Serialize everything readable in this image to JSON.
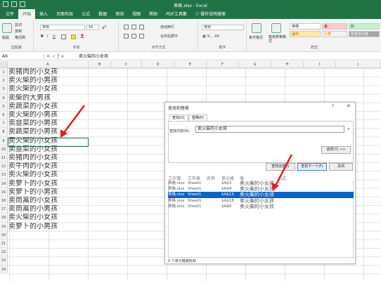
{
  "window": {
    "title": "表格.xlsx - Excel"
  },
  "tabs": [
    "文件",
    "开始",
    "插入",
    "页面布局",
    "公式",
    "数据",
    "审阅",
    "视图",
    "帮助",
    "PDF工具集"
  ],
  "active_tab": "开始",
  "tell_me": "操作说明搜索",
  "ribbon": {
    "clipboard": {
      "label": "剪贴板",
      "paste": "粘贴",
      "cut": "剪切",
      "copy": "复制",
      "format_painter": "格式刷"
    },
    "font": {
      "label": "字体",
      "font_name": "宋体",
      "font_size": "16"
    },
    "alignment": {
      "label": "对齐方式",
      "wrap": "自动换行",
      "merge": "合并后居中"
    },
    "number": {
      "label": "数字",
      "format": "常规"
    },
    "styles": {
      "label": "样式",
      "conditional": "条件格式",
      "table": "套用表格格式",
      "normal": "常规",
      "bad": "差",
      "good": "好",
      "neutral": "适中",
      "calc": "计算",
      "check": "检查单元格"
    }
  },
  "formula_bar": {
    "name_box": "A9",
    "content": "卖火柴的小女孩"
  },
  "columns": [
    "A",
    "B",
    "C",
    "D",
    "E",
    "F",
    "G",
    "H",
    "I",
    "J"
  ],
  "rows": [
    {
      "num": "1",
      "a": "卖猪肉的小女孩"
    },
    {
      "num": "2",
      "a": "卖火柴的小男孩"
    },
    {
      "num": "3",
      "a": "卖火柴的小女孩"
    },
    {
      "num": "4",
      "a": "卖柴的大男孩"
    },
    {
      "num": "5",
      "a": "卖蔬菜的小女孩"
    },
    {
      "num": "6",
      "a": "卖火柴的小男孩"
    },
    {
      "num": "7",
      "a": "卖韭菜的小男孩"
    },
    {
      "num": "8",
      "a": "卖蔬菜的小男孩"
    },
    {
      "num": "9",
      "a": "卖火柴的小女孩"
    },
    {
      "num": "10",
      "a": "卖韭菜的小女孩"
    },
    {
      "num": "11",
      "a": "卖猪肉的小女孩"
    },
    {
      "num": "12",
      "a": "卖牛肉的小女孩"
    },
    {
      "num": "13",
      "a": "卖火柴的小女孩"
    },
    {
      "num": "14",
      "a": "卖萝卜的小女孩"
    },
    {
      "num": "15",
      "a": "卖萝卜的小男孩"
    },
    {
      "num": "16",
      "a": "卖茼蒿的小女孩"
    },
    {
      "num": "17",
      "a": "卖茼蒿的小男孩"
    },
    {
      "num": "18",
      "a": "卖火柴的小女孩"
    },
    {
      "num": "19",
      "a": "卖萝卜的小男孩"
    },
    {
      "num": "20",
      "a": ""
    },
    {
      "num": "21",
      "a": ""
    },
    {
      "num": "22",
      "a": ""
    },
    {
      "num": "23",
      "a": ""
    },
    {
      "num": "24",
      "a": ""
    }
  ],
  "dialog": {
    "title": "查找和替换",
    "help": "?",
    "close": "✕",
    "tabs": [
      "查找(D)",
      "替换(P)"
    ],
    "find_label": "查找内容(N):",
    "find_value": "卖火柴的小女孩",
    "options_button": "选项(T) >>",
    "find_all_button": "查找全部(I)",
    "find_next_button": "查找下一个(F)",
    "close_button": "关闭",
    "result_headers": [
      "工作簿",
      "工作表",
      "名称",
      "单元格",
      "值",
      "公式"
    ],
    "results": [
      {
        "book": "表格.xlsx",
        "sheet": "Sheet1",
        "cell": "$A$3",
        "value": "卖火柴的小女孩"
      },
      {
        "book": "表格.xlsx",
        "sheet": "Sheet1",
        "cell": "$A$9",
        "value": "卖火柴的小女孩"
      },
      {
        "book": "表格.xlsx",
        "sheet": "Sheet1",
        "cell": "$A$13",
        "value": "卖火柴的小女孩"
      },
      {
        "book": "表格.xlsx",
        "sheet": "Sheet1",
        "cell": "$A$18",
        "value": "卖火柴的小女孩"
      },
      {
        "book": "表格.xlsx",
        "sheet": "Sheet1",
        "cell": "$A$6",
        "value": "卖火柴的小女孩"
      }
    ],
    "selected_result": 2,
    "status": "5 个单元格被找到"
  },
  "colors": {
    "excel_green": "#217346",
    "selection_blue": "#0a64c8",
    "arrow_red": "#e02020"
  }
}
